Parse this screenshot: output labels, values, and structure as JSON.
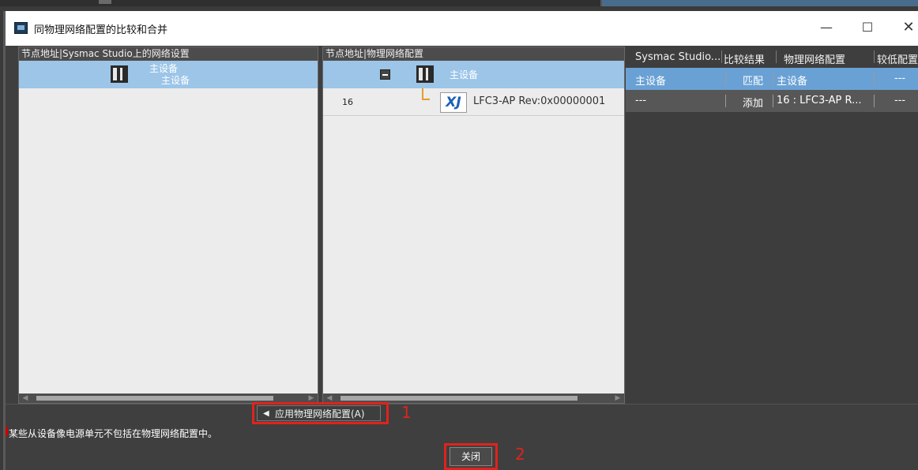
{
  "window": {
    "title": "同物理网络配置的比较和合并",
    "minimize": "—",
    "maximize": "☐",
    "close": "✕"
  },
  "left_pane": {
    "header": "节点地址|Sysmac Studio上的网络设置",
    "selected_row": {
      "label1": "主设备",
      "label2": "主设备"
    }
  },
  "mid_pane": {
    "header": "节点地址|物理网络配置",
    "rows": [
      {
        "label": "主设备"
      },
      {
        "node": "16",
        "icon_text": "XJ",
        "label": "LFC3-AP Rev:0x00000001"
      }
    ]
  },
  "right_grid": {
    "columns": [
      "Sysmac Studio...",
      "比较结果",
      "物理网络配置",
      "较低配置"
    ],
    "rows": [
      {
        "studio": "主设备",
        "result": "匹配",
        "physical": "主设备",
        "lower": "---"
      },
      {
        "studio": "---",
        "result": "添加",
        "physical": "16 : LFC3-AP R...",
        "lower": "---"
      }
    ]
  },
  "footer": {
    "apply_label": "应用物理网络配置(A)",
    "info_text": "某些从设备像电源单元不包括在物理网络配置中。",
    "close_label": "关闭",
    "annotation_1": "1",
    "annotation_2": "2"
  },
  "colors": {
    "selected_row": "#9cc5e8",
    "grid_highlight": "#6aa1d5",
    "annotation_red": "#e0231c",
    "tree_line": "#e89b2a"
  },
  "icons": [
    "app-icon",
    "rack-device-icon",
    "collapse-icon",
    "xj-device-icon",
    "apply-arrow-icon"
  ]
}
